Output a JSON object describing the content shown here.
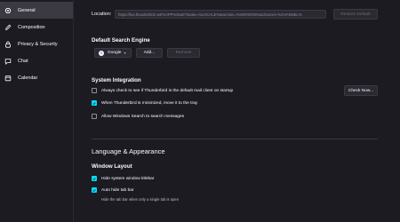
{
  "sidebar": {
    "items": [
      {
        "label": "General",
        "icon": "gear-icon",
        "active": true
      },
      {
        "label": "Composition",
        "icon": "pencil-icon"
      },
      {
        "label": "Privacy & Security",
        "icon": "lock-icon"
      },
      {
        "label": "Chat",
        "icon": "chat-icon"
      },
      {
        "label": "Calendar",
        "icon": "calendar-icon"
      }
    ]
  },
  "location": {
    "label": "Location:",
    "value": "https://live.thunderbird.net/%APP%/start?locale=%LOCALE%&version=%VERSION%&channel=%CHANNEL%",
    "restore_label": "Restore Default"
  },
  "search_engine": {
    "heading": "Default Search Engine",
    "selected": "Google",
    "add_label": "Add...",
    "remove_label": "Remove"
  },
  "system_integration": {
    "heading": "System Integration",
    "check_default": "Always check to see if Thunderbird is the default mail client on startup",
    "check_now_label": "Check Now...",
    "minimize_tray": "When Thunderbird is minimized, move it to the tray",
    "windows_search": "Allow Windows Search to search messages"
  },
  "language_appearance": {
    "heading": "Language & Appearance"
  },
  "window_layout": {
    "heading": "Window Layout",
    "hide_titlebar": "Hide system window titlebar",
    "auto_hide_tabbar": "Auto hide tab bar",
    "auto_hide_note": "Hide the tab bar when only a single tab is open"
  },
  "colors": {
    "accent": "#00ddff",
    "background": "#1c1b22",
    "active_item": "#3b3a42"
  }
}
